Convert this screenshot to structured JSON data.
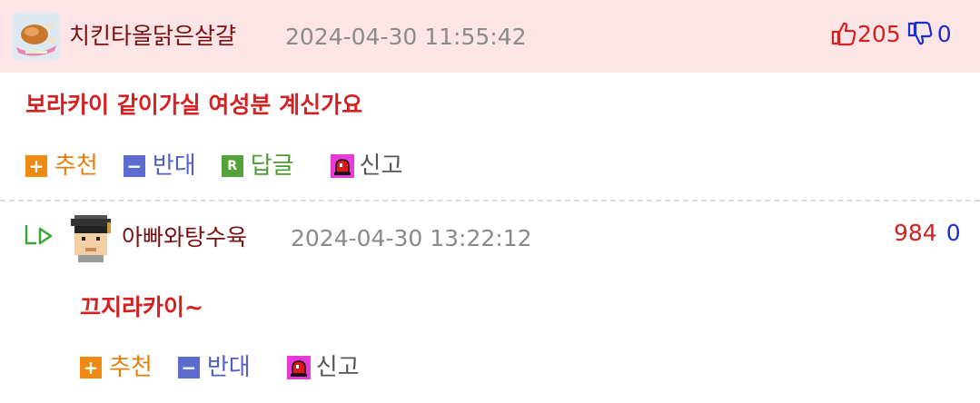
{
  "comment": {
    "nickname": "치킨타올닭은살걀",
    "date": "2024-04-30 11:55:42",
    "up_count": "205",
    "down_count": "0",
    "text": "보라카이 같이가실 여성분 계신가요",
    "actions": {
      "recommend": "추천",
      "oppose": "반대",
      "reply": "답글",
      "report": "신고",
      "reply_badge": "R"
    }
  },
  "reply": {
    "nickname": "아빠와탕수육",
    "date": "2024-04-30 13:22:12",
    "up_count": "984",
    "down_count": "0",
    "text": "끄지라카이~",
    "actions": {
      "recommend": "추천",
      "oppose": "반대",
      "report": "신고"
    }
  },
  "colors": {
    "header_bg": "#fde4e6",
    "nickname": "#7a0f0f",
    "content": "#d61f1f",
    "up": "#d61f1f",
    "down": "#1b2fc9",
    "recommend": "#ef8a11",
    "oppose": "#5b6bcf",
    "reply": "#54a33a"
  }
}
